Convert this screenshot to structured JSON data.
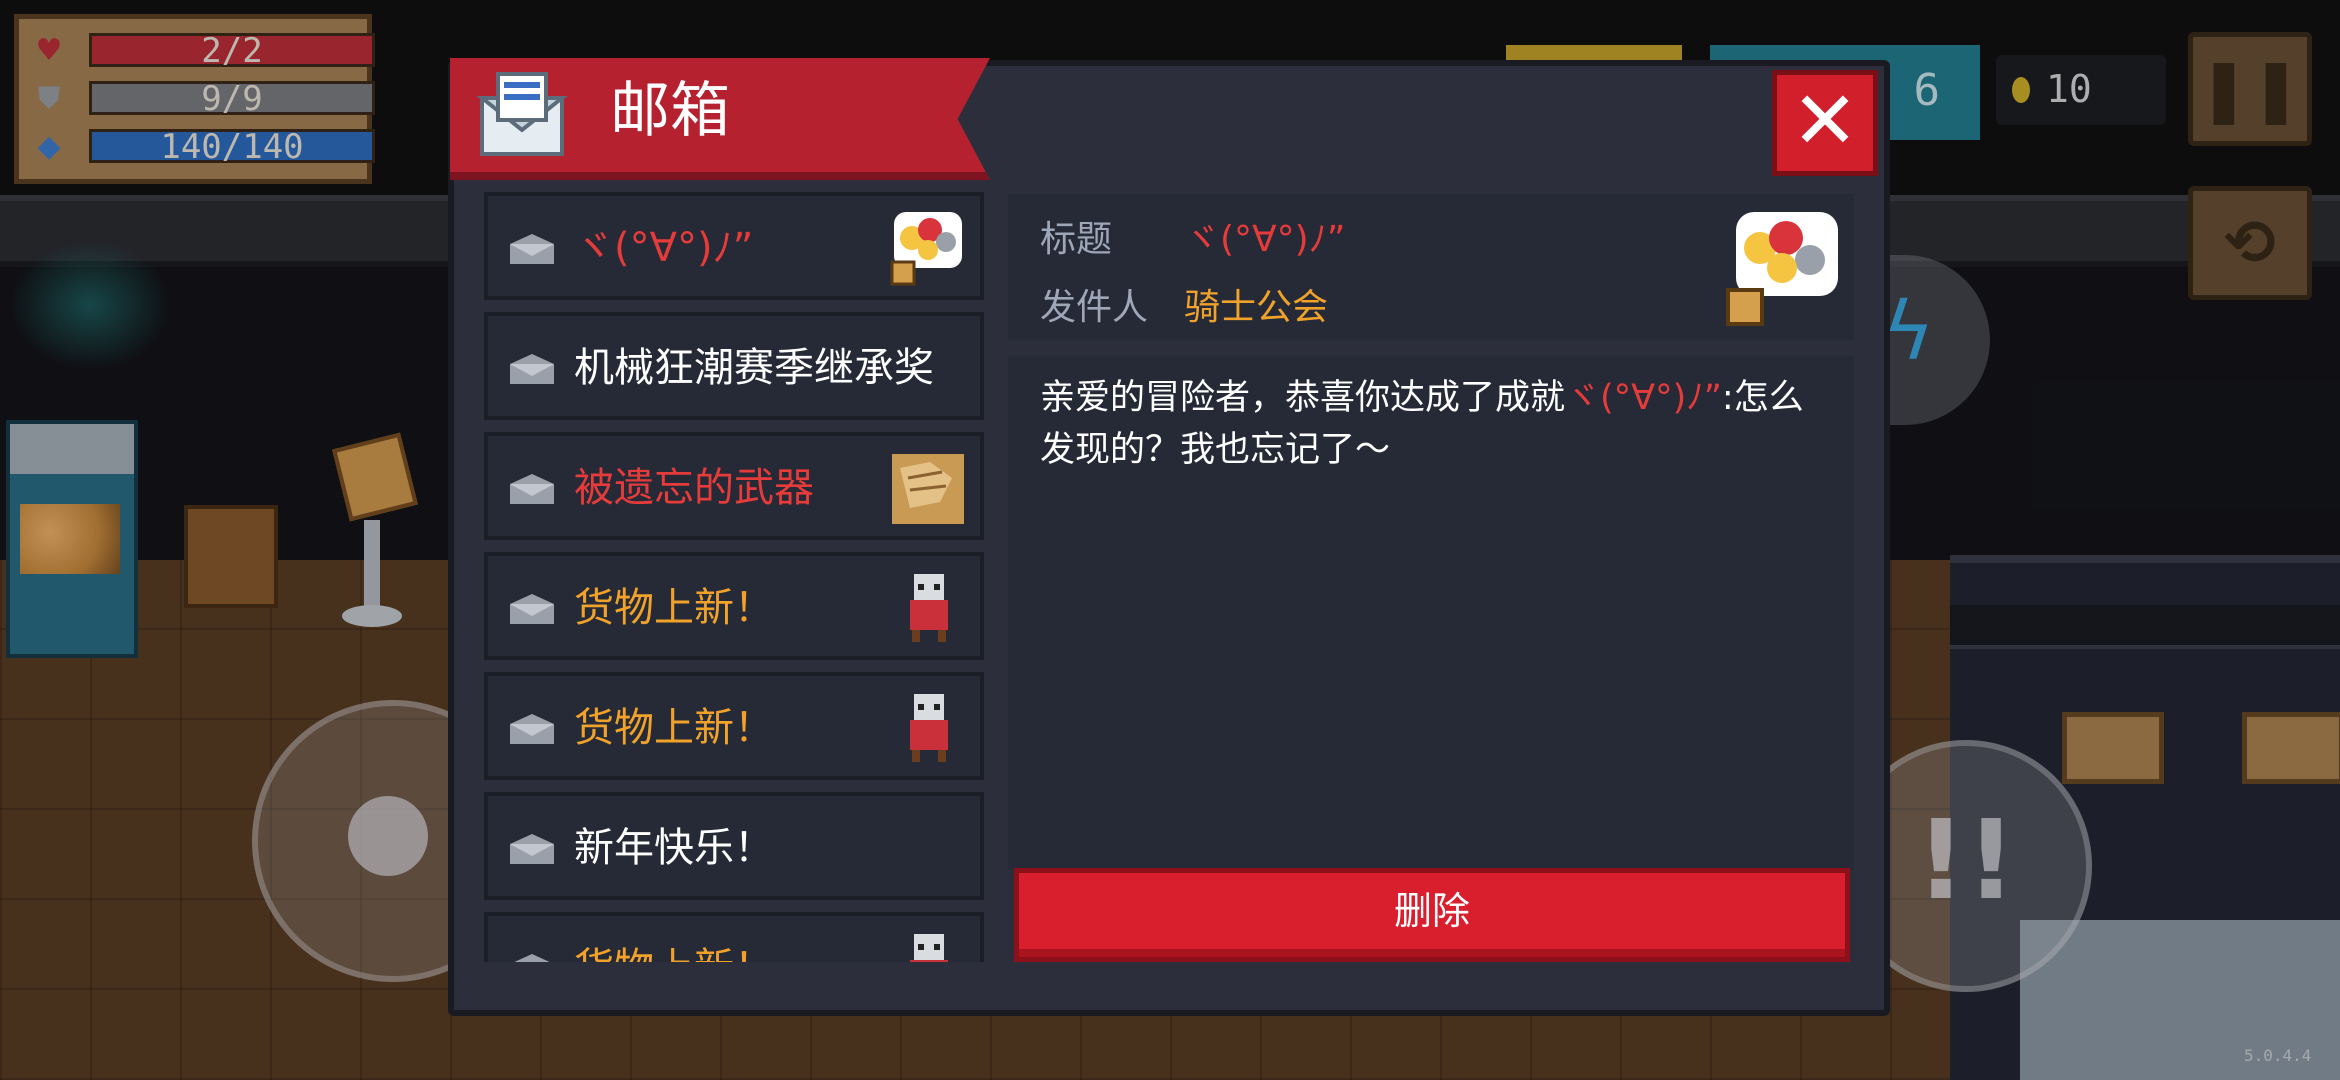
{
  "hud": {
    "health": "2/2",
    "armor": "9/9",
    "energy": "140/140",
    "gems": "6",
    "coins": "10",
    "version": "5.0.4.4"
  },
  "mailbox": {
    "title": "邮箱",
    "close_label": "✕",
    "items": [
      {
        "subject": "ヾ(°∀°)ﾉ”",
        "color": "#e53b3b",
        "thumb": "emoji-sticker-icon"
      },
      {
        "subject": "机械狂潮赛季继承奖",
        "color": "#ffffff",
        "thumb": ""
      },
      {
        "subject": "被遗忘的武器",
        "color": "#e53b3b",
        "thumb": "scroll-icon"
      },
      {
        "subject": "货物上新！",
        "color": "#f0a22a",
        "thumb": "merchant-icon"
      },
      {
        "subject": "货物上新！",
        "color": "#f0a22a",
        "thumb": "merchant-icon"
      },
      {
        "subject": "新年快乐！",
        "color": "#ffffff",
        "thumb": ""
      },
      {
        "subject": "货物上新！",
        "color": "#f0a22a",
        "thumb": "merchant-icon"
      }
    ],
    "detail": {
      "title_label": "标题",
      "title_value": "ヾ(°∀°)ﾉ”",
      "sender_label": "发件人",
      "sender_value": "骑士公会",
      "body_prefix": "亲爱的冒险者，恭喜你达成了成就",
      "body_highlight": "ヾ(°∀°)ﾉ”",
      "body_suffix": ":怎么发现的？我也忘记了～",
      "delete_label": "删除"
    }
  }
}
